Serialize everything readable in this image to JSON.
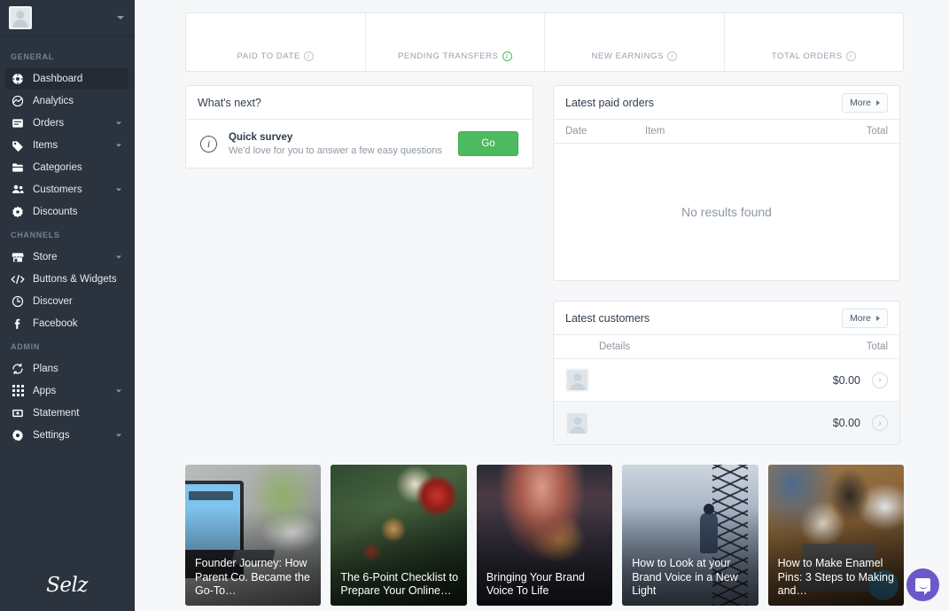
{
  "sidebar": {
    "account": {
      "avatar_alt": "user-avatar",
      "caret": "chevron-down-icon"
    },
    "sections": [
      {
        "label": "GENERAL",
        "items": [
          {
            "label": "Dashboard",
            "icon": "dashboard-icon",
            "active": true,
            "expandable": false
          },
          {
            "label": "Analytics",
            "icon": "analytics-icon",
            "active": false,
            "expandable": false
          },
          {
            "label": "Orders",
            "icon": "orders-icon",
            "active": false,
            "expandable": true
          },
          {
            "label": "Items",
            "icon": "tag-icon",
            "active": false,
            "expandable": true
          },
          {
            "label": "Categories",
            "icon": "folder-icon",
            "active": false,
            "expandable": false
          },
          {
            "label": "Customers",
            "icon": "customers-icon",
            "active": false,
            "expandable": true
          },
          {
            "label": "Discounts",
            "icon": "discount-icon",
            "active": false,
            "expandable": false
          }
        ]
      },
      {
        "label": "CHANNELS",
        "items": [
          {
            "label": "Store",
            "icon": "store-icon",
            "active": false,
            "expandable": true
          },
          {
            "label": "Buttons & Widgets",
            "icon": "code-icon",
            "active": false,
            "expandable": false
          },
          {
            "label": "Discover",
            "icon": "discover-icon",
            "active": false,
            "expandable": false
          },
          {
            "label": "Facebook",
            "icon": "facebook-icon",
            "active": false,
            "expandable": false
          }
        ]
      },
      {
        "label": "ADMIN",
        "items": [
          {
            "label": "Plans",
            "icon": "refresh-icon",
            "active": false,
            "expandable": false
          },
          {
            "label": "Apps",
            "icon": "apps-grid-icon",
            "active": false,
            "expandable": true
          },
          {
            "label": "Statement",
            "icon": "statement-icon",
            "active": false,
            "expandable": false
          },
          {
            "label": "Settings",
            "icon": "gear-icon",
            "active": false,
            "expandable": true
          }
        ]
      }
    ],
    "logo": "Selz"
  },
  "stats": [
    {
      "label": "PAID TO DATE",
      "value": "",
      "info": "info-icon",
      "info_color": "#bcc5ce"
    },
    {
      "label": "PENDING TRANSFERS",
      "value": "",
      "info": "info-icon",
      "info_color": "#4cba5f"
    },
    {
      "label": "NEW EARNINGS",
      "value": "",
      "info": "info-icon",
      "info_color": "#bcc5ce"
    },
    {
      "label": "TOTAL ORDERS",
      "value": "",
      "info": "info-icon",
      "info_color": "#bcc5ce"
    }
  ],
  "whats_next": {
    "title": "What's next?",
    "item_title": "Quick survey",
    "item_subtitle": "We'd love for you to answer a few easy questions",
    "action_label": "Go"
  },
  "latest_paid_orders": {
    "title": "Latest paid orders",
    "more_label": "More",
    "columns": [
      "Date",
      "Item",
      "Total"
    ],
    "rows": [],
    "empty_message": "No results found"
  },
  "latest_customers": {
    "title": "Latest customers",
    "more_label": "More",
    "columns": [
      "Details",
      "Total"
    ],
    "rows": [
      {
        "name": "",
        "total": "$0.00"
      },
      {
        "name": "",
        "total": "$0.00"
      }
    ]
  },
  "blog_posts": [
    {
      "title": "Founder Journey: How Parent Co. Became the Go-To…"
    },
    {
      "title": "The 6-Point Checklist to Prepare Your Online…"
    },
    {
      "title": "Bringing Your Brand Voice To Life"
    },
    {
      "title": "How to Look at your Brand Voice in a New Light"
    },
    {
      "title": "How to Make Enamel Pins: 3 Steps to Making and…"
    }
  ],
  "chat_widget": {
    "name": "intercom-launcher",
    "color": "#6c58c9"
  }
}
